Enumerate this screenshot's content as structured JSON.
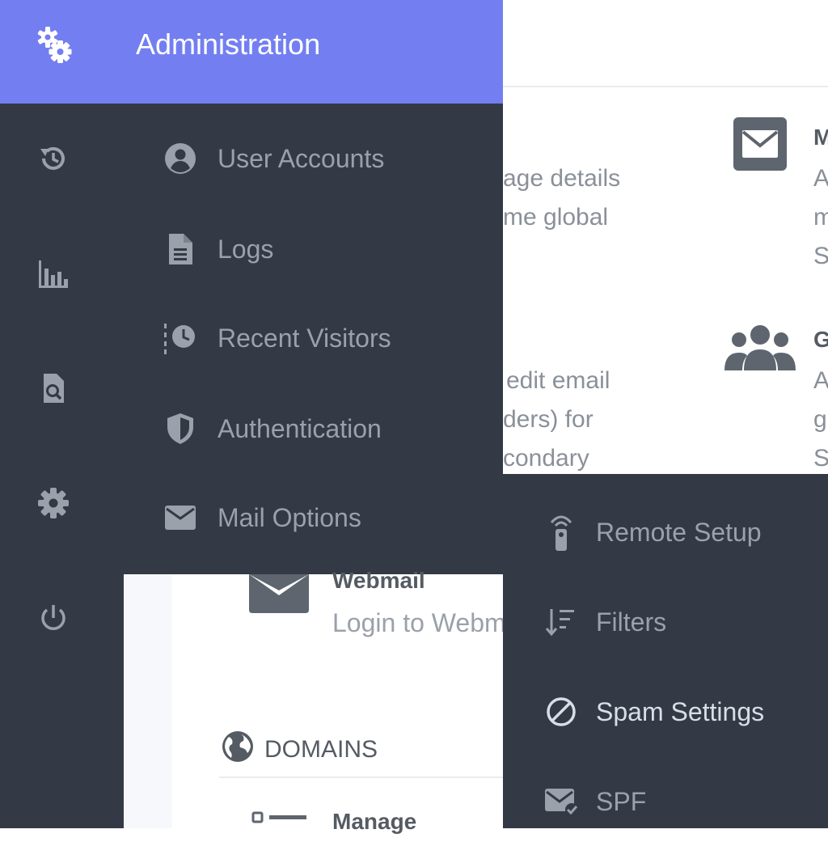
{
  "header": {
    "title": "Administration",
    "icon": "gears-icon"
  },
  "rail": {
    "icons": [
      "history-icon",
      "bar-chart-icon",
      "file-search-icon",
      "gear-icon",
      "power-icon"
    ]
  },
  "admin_menu": {
    "items": [
      {
        "label": "User Accounts",
        "icon": "user-circle-icon"
      },
      {
        "label": "Logs",
        "icon": "file-text-icon"
      },
      {
        "label": "Recent Visitors",
        "icon": "recent-visitors-icon"
      },
      {
        "label": "Authentication",
        "icon": "shield-icon"
      },
      {
        "label": "Mail Options",
        "icon": "envelope-icon"
      }
    ]
  },
  "background_cards": {
    "card1_lines": [
      "age details",
      "me global"
    ],
    "card2_lines": [
      "edit email",
      "ders) for",
      "condary"
    ],
    "right_card1": {
      "title_fragment": "M",
      "lines": [
        "A",
        "m",
        "S"
      ],
      "icon": "envelope-box-icon"
    },
    "right_card2": {
      "title_fragment": "G",
      "lines": [
        "A",
        "g",
        "S"
      ],
      "icon": "users-group-icon"
    }
  },
  "lower_panel": {
    "webmail_title": "Webmail",
    "webmail_desc": "Login to Webm",
    "domains_label": "DOMAINS",
    "manage_title": "Manage"
  },
  "mail_menu": {
    "items": [
      {
        "label": "Remote Setup",
        "icon": "remote-icon"
      },
      {
        "label": "Filters",
        "icon": "sort-filter-icon"
      },
      {
        "label": "Spam Settings",
        "icon": "ban-icon",
        "active": true
      },
      {
        "label": "SPF",
        "icon": "envelope-check-icon"
      }
    ]
  },
  "colors": {
    "header": "#737ff0",
    "sidebar": "#333a45",
    "menu_text": "#9aa1ab",
    "active_text": "#d9dee6"
  }
}
